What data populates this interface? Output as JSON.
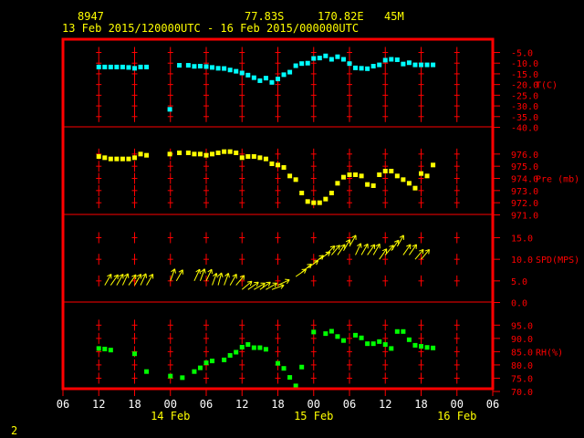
{
  "header": {
    "station_id": "8947",
    "lat": "77.83S",
    "lon": "170.82E",
    "elevation": "45M",
    "time_range": "13 Feb 2015/120000UTC - 16 Feb 2015/000000UTC"
  },
  "footer": {
    "page": "2"
  },
  "colors": {
    "frame": "#ff0000",
    "text_header": "#ffff00",
    "temperature": "#00ffff",
    "pressure": "#ffff00",
    "wind": "#ffff00",
    "rh": "#00ff00"
  },
  "chart_data": [
    {
      "type": "scatter",
      "name": "temperature",
      "ylabel": "T(C)",
      "ylim": [
        -40,
        -5
      ],
      "ticks": [
        -5,
        -10,
        -15,
        -20,
        -25,
        -30,
        -35,
        -40
      ],
      "tick_labels": [
        "-5.0",
        "-10.0",
        "-15.0",
        "-20.0",
        "-25.0",
        "-30.0",
        "-35.0",
        "-40.0"
      ],
      "x_hours": [
        12,
        13,
        14,
        15,
        16,
        17,
        18,
        19,
        20,
        23.9,
        25.5,
        27,
        28,
        29,
        30,
        31,
        32,
        33,
        34,
        35,
        36,
        37,
        38,
        39,
        40,
        41,
        42,
        43,
        44,
        45,
        46,
        47,
        48,
        49,
        50,
        51,
        52,
        53,
        54,
        55,
        56,
        57,
        58,
        59,
        60,
        61,
        62,
        63,
        64,
        65,
        66,
        67,
        68
      ],
      "values": [
        -11.8,
        -11.8,
        -11.8,
        -11.8,
        -11.8,
        -12,
        -12.4,
        -11.8,
        -11.8,
        -31.6,
        -11,
        -11,
        -11.5,
        -11.4,
        -11.6,
        -12,
        -12.4,
        -12.5,
        -13.2,
        -13.8,
        -14.6,
        -15.6,
        -16.8,
        -18.2,
        -17,
        -19,
        -17.4,
        -15.4,
        -14.2,
        -11.2,
        -10.2,
        -10,
        -7.8,
        -7.6,
        -6.6,
        -8.2,
        -7,
        -8.2,
        -10.2,
        -12.2,
        -12.4,
        -12.6,
        -11.4,
        -10.8,
        -8.6,
        -8.2,
        -8.4,
        -10.4,
        -9.8,
        -10.8,
        -10.8,
        -10.8,
        -10.8
      ]
    },
    {
      "type": "scatter",
      "name": "pressure",
      "ylabel": "Pre (mb)",
      "ylim": [
        971,
        977
      ],
      "ticks": [
        976,
        975,
        974,
        973,
        972,
        971
      ],
      "tick_labels": [
        "976.0",
        "975.0",
        "974.0",
        "973.0",
        "972.0",
        "971.0"
      ],
      "x_hours": [
        12,
        13,
        14,
        15,
        16,
        17,
        18,
        19,
        20,
        23.9,
        25.5,
        27,
        28,
        29,
        30,
        31,
        32,
        33,
        34,
        35,
        36,
        37,
        38,
        39,
        40,
        41,
        42,
        43,
        44,
        45,
        46,
        47,
        48,
        49,
        50,
        51,
        52,
        53,
        54,
        55,
        56,
        57,
        58,
        59,
        60,
        61,
        62,
        63,
        64,
        65,
        66,
        67,
        68
      ],
      "values": [
        975.8,
        975.7,
        975.6,
        975.6,
        975.6,
        975.6,
        975.7,
        976.0,
        975.9,
        976.0,
        976.1,
        976.1,
        976.0,
        976.0,
        975.9,
        976.0,
        976.1,
        976.2,
        976.2,
        976.1,
        975.7,
        975.8,
        975.8,
        975.7,
        975.6,
        975.2,
        975.1,
        974.9,
        974.2,
        973.9,
        972.8,
        972.1,
        972.0,
        972.0,
        972.3,
        972.8,
        973.6,
        974.1,
        974.3,
        974.3,
        974.2,
        973.5,
        973.4,
        974.3,
        974.6,
        974.6,
        974.2,
        973.9,
        973.6,
        973.2,
        974.4,
        974.2,
        975.1
      ]
    },
    {
      "type": "barbs",
      "name": "wind",
      "ylabel": "SPD(MPS)",
      "ylim": [
        0,
        15
      ],
      "ticks": [
        15,
        10,
        5,
        0
      ],
      "tick_labels": [
        "15.0",
        "10.0",
        "5.0",
        "0.0"
      ],
      "x_hours": [
        13,
        14,
        15,
        16,
        17,
        18,
        19,
        20,
        24,
        25,
        28,
        29,
        30,
        31,
        32,
        33,
        34,
        35,
        36,
        37,
        38,
        39,
        40,
        41,
        42,
        45,
        46,
        47,
        48,
        49,
        50,
        51,
        52,
        53,
        54,
        55,
        56,
        57,
        58,
        59,
        60,
        61,
        62,
        63,
        64,
        65,
        66
      ],
      "speed": [
        4,
        4,
        4,
        4,
        4,
        4,
        4,
        4,
        5,
        5,
        5,
        5,
        5,
        4,
        4,
        4,
        4,
        4,
        3,
        3,
        3,
        3,
        3,
        3,
        4,
        6,
        7,
        8,
        9,
        10,
        11,
        11,
        11,
        12,
        13,
        11,
        11,
        11,
        11,
        10,
        11,
        12,
        13,
        11,
        11,
        10,
        10
      ],
      "dir_deg": [
        30,
        35,
        30,
        25,
        35,
        30,
        25,
        30,
        20,
        30,
        25,
        20,
        25,
        20,
        15,
        20,
        30,
        40,
        50,
        55,
        60,
        55,
        60,
        70,
        65,
        55,
        50,
        55,
        50,
        55,
        45,
        40,
        35,
        30,
        30,
        25,
        30,
        35,
        30,
        35,
        40,
        35,
        30,
        35,
        35,
        40,
        40
      ]
    },
    {
      "type": "scatter",
      "name": "rh",
      "ylabel": "RH(%)",
      "ylim": [
        70,
        97
      ],
      "ticks": [
        95,
        90,
        85,
        80,
        75,
        70
      ],
      "tick_labels": [
        "95.0",
        "90.0",
        "85.0",
        "80.0",
        "75.0",
        "70.0"
      ],
      "x_hours": [
        12,
        13,
        14,
        18,
        20,
        24,
        26,
        28,
        29,
        30,
        31,
        33,
        34,
        35,
        36,
        37,
        38,
        39,
        40,
        42,
        43,
        44,
        45,
        46,
        48,
        50,
        51,
        52,
        53,
        55,
        56,
        57,
        58,
        59,
        60,
        61,
        62,
        63,
        64,
        65,
        66,
        67,
        68
      ],
      "values": [
        86.2,
        86.0,
        85.6,
        84.2,
        77.5,
        75.8,
        75.2,
        77.5,
        78.9,
        80.8,
        81.5,
        81.9,
        83.6,
        84.8,
        86.7,
        87.7,
        86.5,
        86.5,
        85.9,
        80.6,
        78.7,
        75.3,
        72.1,
        79.2,
        92.4,
        91.8,
        92.7,
        90.7,
        89.2,
        91.2,
        90.2,
        88.0,
        88.0,
        88.8,
        87.7,
        86.2,
        92.6,
        92.6,
        89.5,
        87.4,
        87.0,
        86.6,
        86.4
      ]
    }
  ],
  "x_axis": {
    "hour_labels": [
      "06",
      "12",
      "18",
      "00",
      "06",
      "12",
      "18",
      "00",
      "06",
      "12",
      "18",
      "00",
      "06"
    ],
    "date_labels": [
      "14 Feb",
      "15 Feb",
      "16 Feb"
    ],
    "tick_hours": [
      6,
      12,
      18,
      24,
      30,
      36,
      42,
      48,
      54,
      60,
      66,
      72,
      78
    ],
    "date_hours": [
      24,
      48,
      72
    ]
  }
}
